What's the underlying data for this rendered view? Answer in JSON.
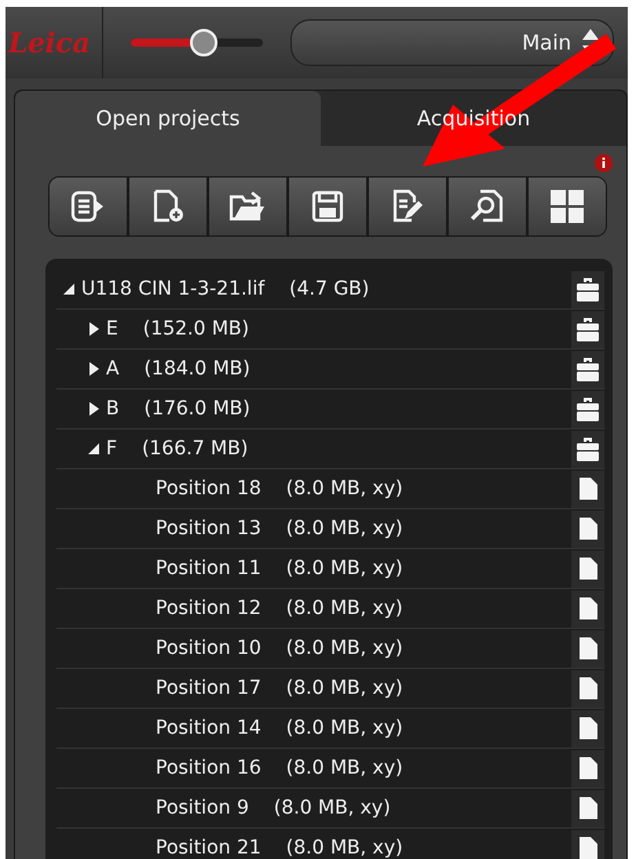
{
  "logo": {
    "text": "Leica"
  },
  "zoom_slider": {
    "level": 0.55
  },
  "view_selector": {
    "value": "Main"
  },
  "tabs": [
    {
      "label": "Open projects",
      "selected": true
    },
    {
      "label": "Acquisition",
      "selected": false
    }
  ],
  "toolbar": [
    {
      "kind": "export"
    },
    {
      "kind": "new"
    },
    {
      "kind": "open"
    },
    {
      "kind": "save"
    },
    {
      "kind": "edit"
    },
    {
      "kind": "find"
    },
    {
      "kind": "grid"
    }
  ],
  "tree": {
    "label": "U118 CIN 1-3-21.lif",
    "size": "(4.7 GB)",
    "kind": "project",
    "expanded": true,
    "children": [
      {
        "label": "E",
        "size": "(152.0 MB)",
        "kind": "folder",
        "expanded": false
      },
      {
        "label": "A",
        "size": "(184.0 MB)",
        "kind": "folder",
        "expanded": false
      },
      {
        "label": "B",
        "size": "(176.0 MB)",
        "kind": "folder",
        "expanded": false
      },
      {
        "label": "F",
        "size": "(166.7 MB)",
        "kind": "folder",
        "expanded": true,
        "children": [
          {
            "label": "Position 18",
            "size": "(8.0 MB, xy)",
            "kind": "image"
          },
          {
            "label": "Position 13",
            "size": "(8.0 MB, xy)",
            "kind": "image"
          },
          {
            "label": "Position 11",
            "size": "(8.0 MB, xy)",
            "kind": "image"
          },
          {
            "label": "Position 12",
            "size": "(8.0 MB, xy)",
            "kind": "image"
          },
          {
            "label": "Position 10",
            "size": "(8.0 MB, xy)",
            "kind": "image"
          },
          {
            "label": "Position 17",
            "size": "(8.0 MB, xy)",
            "kind": "image"
          },
          {
            "label": "Position 14",
            "size": "(8.0 MB, xy)",
            "kind": "image"
          },
          {
            "label": "Position 16",
            "size": "(8.0 MB, xy)",
            "kind": "image"
          },
          {
            "label": "Position 9",
            "size": "(8.0 MB, xy)",
            "kind": "image"
          },
          {
            "label": "Position 21",
            "size": "(8.0 MB, xy)",
            "kind": "image"
          }
        ]
      }
    ]
  }
}
